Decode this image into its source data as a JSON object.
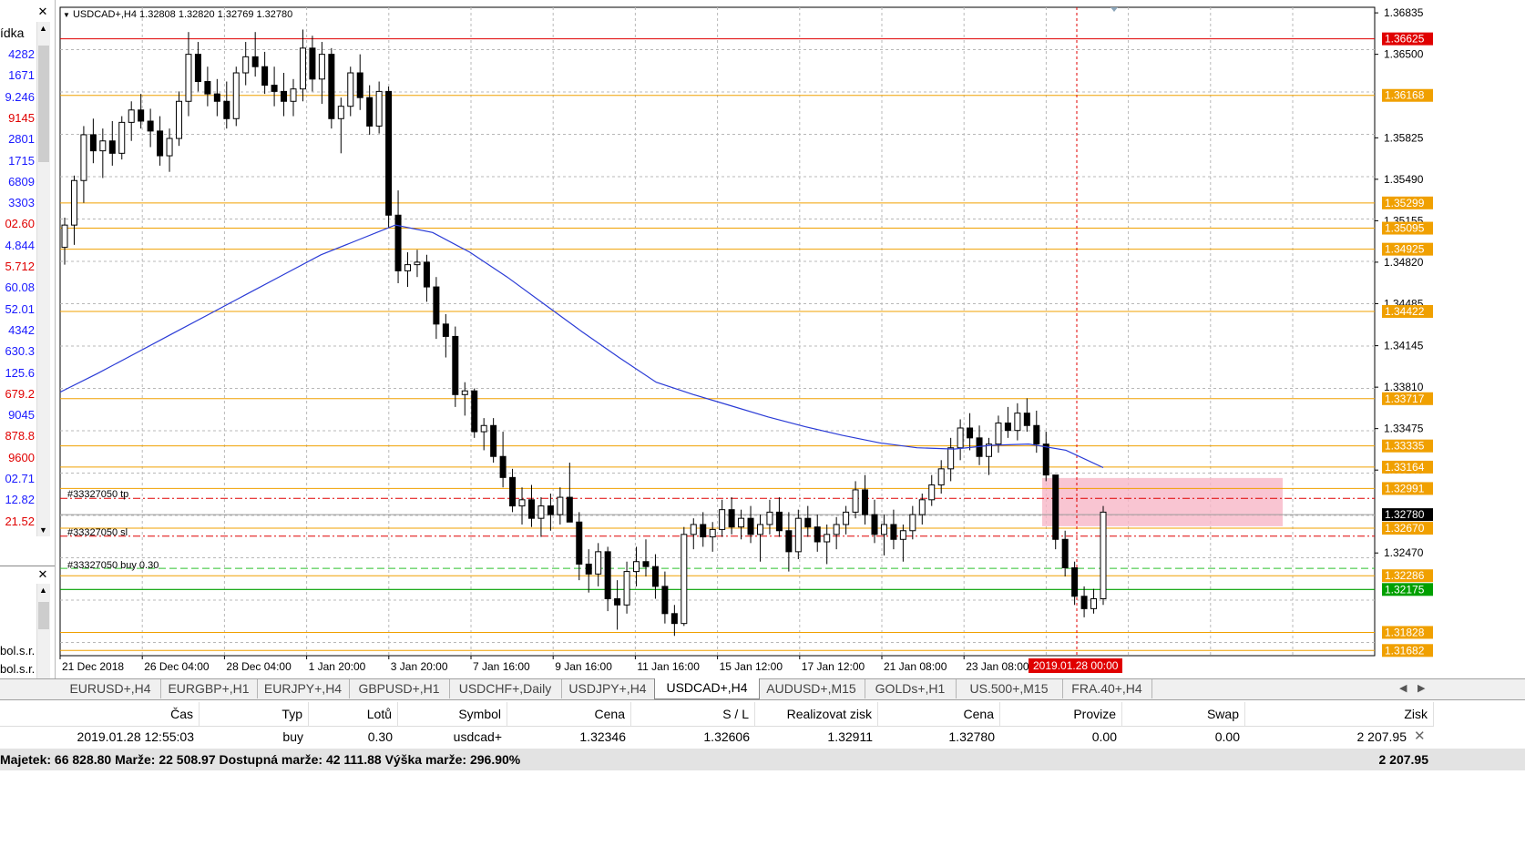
{
  "left_panel": {
    "header": "ídka",
    "rows": [
      {
        "text": "4282",
        "color": "#1a1aff"
      },
      {
        "text": "1671",
        "color": "#1a1aff"
      },
      {
        "text": "9.246",
        "color": "#1a1aff"
      },
      {
        "text": "9145",
        "color": "#e00000"
      },
      {
        "text": "2801",
        "color": "#1a1aff"
      },
      {
        "text": "1715",
        "color": "#1a1aff"
      },
      {
        "text": "6809",
        "color": "#1a1aff"
      },
      {
        "text": "3303",
        "color": "#1a1aff"
      },
      {
        "text": "02.60",
        "color": "#e00000"
      },
      {
        "text": "4.844",
        "color": "#1a1aff"
      },
      {
        "text": "5.712",
        "color": "#e00000"
      },
      {
        "text": "60.08",
        "color": "#1a1aff"
      },
      {
        "text": "52.01",
        "color": "#1a1aff"
      },
      {
        "text": "4342",
        "color": "#1a1aff"
      },
      {
        "text": "630.3",
        "color": "#1a1aff"
      },
      {
        "text": "125.6",
        "color": "#1a1aff"
      },
      {
        "text": "679.2",
        "color": "#e00000"
      },
      {
        "text": "9045",
        "color": "#1a1aff"
      },
      {
        "text": "878.8",
        "color": "#e00000"
      },
      {
        "text": "9600",
        "color": "#e00000"
      },
      {
        "text": "02.71",
        "color": "#1a1aff"
      },
      {
        "text": "12.82",
        "color": "#1a1aff"
      },
      {
        "text": "21.52",
        "color": "#e00000"
      }
    ],
    "nav_rows": [
      "bol.s.r.",
      "bol.s.r."
    ]
  },
  "chart": {
    "symbol_label": "USDCAD+,H4  1.32808 1.32820 1.32769 1.32780",
    "order_labels": {
      "tp": "#33327050 tp",
      "sl": "#33327050 sl",
      "buy": "#33327050 buy 0.30"
    },
    "price_min": 1.3164,
    "price_max": 1.3688,
    "axis_ticks": [
      "1.36835",
      "1.36500",
      "1.35825",
      "1.35490",
      "1.35155",
      "1.34820",
      "1.34485",
      "1.34145",
      "1.33810",
      "1.33475",
      "1.33140",
      "1.32470"
    ],
    "level_lines": [
      {
        "price": 1.36625,
        "label": "1.36625",
        "color": "#e00000"
      },
      {
        "price": 1.36168,
        "label": "1.36168",
        "color": "#f0a000"
      },
      {
        "price": 1.35299,
        "label": "1.35299",
        "color": "#f0a000"
      },
      {
        "price": 1.35095,
        "label": "1.35095",
        "color": "#f0a000"
      },
      {
        "price": 1.34925,
        "label": "1.34925",
        "color": "#f0a000"
      },
      {
        "price": 1.34422,
        "label": "1.34422",
        "color": "#f0a000"
      },
      {
        "price": 1.33717,
        "label": "1.33717",
        "color": "#f0a000"
      },
      {
        "price": 1.33335,
        "label": "1.33335",
        "color": "#f0a000"
      },
      {
        "price": 1.33164,
        "label": "1.33164",
        "color": "#f0a000"
      },
      {
        "price": 1.32991,
        "label": "1.32991",
        "color": "#f0a000"
      },
      {
        "price": 1.3267,
        "label": "1.32670",
        "color": "#f0a000"
      },
      {
        "price": 1.32286,
        "label": "1.32286",
        "color": "#f0a000"
      },
      {
        "price": 1.31828,
        "label": "1.31828",
        "color": "#f0a000"
      },
      {
        "price": 1.31682,
        "label": "1.31682",
        "color": "#f0a000"
      }
    ],
    "current_price": {
      "price": 1.3278,
      "label": "1.32780"
    },
    "entry_price": {
      "price": 1.32175,
      "label": "1.32175"
    },
    "tp_price": 1.32911,
    "sl_price": 1.32606,
    "buy_price": 1.32346,
    "zone": {
      "price_top": 1.33076,
      "price_bottom": 1.32686
    },
    "time_labels": [
      "21 Dec 2018",
      "26 Dec 04:00",
      "28 Dec 04:00",
      "1 Jan 20:00",
      "3 Jan 20:00",
      "7 Jan 16:00",
      "9 Jan 16:00",
      "11 Jan 16:00",
      "15 Jan 12:00",
      "17 Jan 12:00",
      "21 Jan 08:00",
      "23 Jan 08:00"
    ],
    "cursor_time_label": "2019.01.28 00:00",
    "ma_points": [
      [
        1.3377
      ],
      [
        1.3392
      ],
      [
        1.3408
      ],
      [
        1.3424
      ],
      [
        1.344
      ],
      [
        1.3456
      ],
      [
        1.3472
      ],
      [
        1.3488
      ],
      [
        1.35
      ],
      [
        1.3512
      ],
      [
        1.3506
      ],
      [
        1.349
      ],
      [
        1.347
      ],
      [
        1.3448
      ],
      [
        1.3426
      ],
      [
        1.3405
      ],
      [
        1.3385
      ],
      [
        1.3375
      ],
      [
        1.3366
      ],
      [
        1.3357
      ],
      [
        1.3349
      ],
      [
        1.3342
      ],
      [
        1.3336
      ],
      [
        1.3332
      ],
      [
        1.3331
      ],
      [
        1.3334
      ],
      [
        1.3335
      ],
      [
        1.333
      ],
      [
        1.3316
      ]
    ],
    "candles": [
      [
        1.3494,
        1.3518,
        1.348,
        1.3512
      ],
      [
        1.3512,
        1.3552,
        1.3496,
        1.3548
      ],
      [
        1.3548,
        1.3592,
        1.353,
        1.3585
      ],
      [
        1.3585,
        1.3598,
        1.3562,
        1.3572
      ],
      [
        1.3572,
        1.359,
        1.355,
        1.358
      ],
      [
        1.358,
        1.3596,
        1.356,
        1.357
      ],
      [
        1.357,
        1.36,
        1.3565,
        1.3595
      ],
      [
        1.3595,
        1.3612,
        1.358,
        1.3605
      ],
      [
        1.3605,
        1.3618,
        1.359,
        1.3596
      ],
      [
        1.3596,
        1.3606,
        1.3575,
        1.3588
      ],
      [
        1.3588,
        1.36,
        1.356,
        1.3568
      ],
      [
        1.3568,
        1.359,
        1.3555,
        1.3582
      ],
      [
        1.3582,
        1.362,
        1.3576,
        1.3612
      ],
      [
        1.3612,
        1.3668,
        1.36,
        1.365
      ],
      [
        1.365,
        1.366,
        1.362,
        1.3628
      ],
      [
        1.3628,
        1.364,
        1.3608,
        1.3618
      ],
      [
        1.3618,
        1.363,
        1.36,
        1.3612
      ],
      [
        1.3612,
        1.3628,
        1.359,
        1.3598
      ],
      [
        1.3598,
        1.364,
        1.3592,
        1.3635
      ],
      [
        1.3635,
        1.366,
        1.3625,
        1.3648
      ],
      [
        1.3648,
        1.3668,
        1.3632,
        1.364
      ],
      [
        1.364,
        1.3652,
        1.3618,
        1.3625
      ],
      [
        1.3625,
        1.364,
        1.3608,
        1.362
      ],
      [
        1.362,
        1.3635,
        1.36,
        1.3612
      ],
      [
        1.3612,
        1.363,
        1.36,
        1.3622
      ],
      [
        1.3622,
        1.367,
        1.3612,
        1.3655
      ],
      [
        1.3655,
        1.3665,
        1.362,
        1.363
      ],
      [
        1.363,
        1.366,
        1.361,
        1.365
      ],
      [
        1.365,
        1.3655,
        1.359,
        1.3598
      ],
      [
        1.3598,
        1.3615,
        1.357,
        1.3608
      ],
      [
        1.3608,
        1.364,
        1.36,
        1.3635
      ],
      [
        1.3635,
        1.365,
        1.3605,
        1.3615
      ],
      [
        1.3615,
        1.3625,
        1.3585,
        1.3592
      ],
      [
        1.3592,
        1.3628,
        1.3586,
        1.362
      ],
      [
        1.362,
        1.3624,
        1.351,
        1.352
      ],
      [
        1.352,
        1.354,
        1.3465,
        1.3475
      ],
      [
        1.3475,
        1.349,
        1.3462,
        1.348
      ],
      [
        1.348,
        1.3492,
        1.347,
        1.3482
      ],
      [
        1.3482,
        1.3488,
        1.345,
        1.3462
      ],
      [
        1.3462,
        1.347,
        1.342,
        1.3432
      ],
      [
        1.3432,
        1.344,
        1.3405,
        1.3422
      ],
      [
        1.3422,
        1.343,
        1.3365,
        1.3375
      ],
      [
        1.3375,
        1.3385,
        1.3358,
        1.3378
      ],
      [
        1.3378,
        1.338,
        1.334,
        1.3345
      ],
      [
        1.3345,
        1.3356,
        1.333,
        1.335
      ],
      [
        1.335,
        1.3356,
        1.332,
        1.3325
      ],
      [
        1.3325,
        1.3345,
        1.33,
        1.3308
      ],
      [
        1.3308,
        1.3315,
        1.328,
        1.3285
      ],
      [
        1.3285,
        1.33,
        1.327,
        1.329
      ],
      [
        1.329,
        1.3302,
        1.3268,
        1.3275
      ],
      [
        1.3275,
        1.3292,
        1.326,
        1.3285
      ],
      [
        1.3285,
        1.3295,
        1.3265,
        1.3278
      ],
      [
        1.3278,
        1.33,
        1.327,
        1.3292
      ],
      [
        1.3292,
        1.332,
        1.3285,
        1.3272
      ],
      [
        1.3272,
        1.328,
        1.3225,
        1.3238
      ],
      [
        1.3238,
        1.325,
        1.3215,
        1.323
      ],
      [
        1.323,
        1.3255,
        1.322,
        1.3248
      ],
      [
        1.3248,
        1.3252,
        1.32,
        1.321
      ],
      [
        1.321,
        1.3225,
        1.3185,
        1.3205
      ],
      [
        1.3205,
        1.324,
        1.3198,
        1.3232
      ],
      [
        1.3232,
        1.3252,
        1.322,
        1.324
      ],
      [
        1.324,
        1.3258,
        1.3228,
        1.3236
      ],
      [
        1.3236,
        1.3246,
        1.321,
        1.322
      ],
      [
        1.322,
        1.3232,
        1.319,
        1.3198
      ],
      [
        1.3198,
        1.3205,
        1.318,
        1.319
      ],
      [
        1.319,
        1.3268,
        1.3188,
        1.3262
      ],
      [
        1.3262,
        1.3275,
        1.325,
        1.327
      ],
      [
        1.327,
        1.328,
        1.3252,
        1.326
      ],
      [
        1.326,
        1.3272,
        1.3248,
        1.3266
      ],
      [
        1.3266,
        1.329,
        1.326,
        1.3282
      ],
      [
        1.3282,
        1.3292,
        1.3262,
        1.3268
      ],
      [
        1.3268,
        1.3282,
        1.3258,
        1.3275
      ],
      [
        1.3275,
        1.3285,
        1.3255,
        1.3262
      ],
      [
        1.3262,
        1.3278,
        1.324,
        1.327
      ],
      [
        1.327,
        1.329,
        1.3262,
        1.328
      ],
      [
        1.328,
        1.3292,
        1.326,
        1.3265
      ],
      [
        1.3265,
        1.328,
        1.3232,
        1.3248
      ],
      [
        1.3248,
        1.3282,
        1.3242,
        1.3275
      ],
      [
        1.3275,
        1.3285,
        1.326,
        1.3268
      ],
      [
        1.3268,
        1.3278,
        1.3248,
        1.3256
      ],
      [
        1.3256,
        1.327,
        1.3238,
        1.3262
      ],
      [
        1.3262,
        1.3276,
        1.325,
        1.327
      ],
      [
        1.327,
        1.3285,
        1.3262,
        1.328
      ],
      [
        1.328,
        1.3305,
        1.3275,
        1.3298
      ],
      [
        1.3298,
        1.331,
        1.327,
        1.3278
      ],
      [
        1.3278,
        1.329,
        1.3255,
        1.3262
      ],
      [
        1.3262,
        1.3278,
        1.3245,
        1.327
      ],
      [
        1.327,
        1.3282,
        1.325,
        1.3258
      ],
      [
        1.3258,
        1.327,
        1.324,
        1.3265
      ],
      [
        1.3265,
        1.3285,
        1.3258,
        1.3278
      ],
      [
        1.3278,
        1.3295,
        1.327,
        1.329
      ],
      [
        1.329,
        1.331,
        1.3285,
        1.3302
      ],
      [
        1.3302,
        1.3322,
        1.3295,
        1.3315
      ],
      [
        1.3315,
        1.334,
        1.3305,
        1.3332
      ],
      [
        1.3332,
        1.3355,
        1.3322,
        1.3348
      ],
      [
        1.3348,
        1.336,
        1.333,
        1.334
      ],
      [
        1.334,
        1.335,
        1.3318,
        1.3325
      ],
      [
        1.3325,
        1.334,
        1.331,
        1.3335
      ],
      [
        1.3335,
        1.3358,
        1.3328,
        1.3352
      ],
      [
        1.3352,
        1.3365,
        1.334,
        1.3346
      ],
      [
        1.3346,
        1.3368,
        1.3338,
        1.336
      ],
      [
        1.336,
        1.3372,
        1.3345,
        1.335
      ],
      [
        1.335,
        1.3362,
        1.3328,
        1.3335
      ],
      [
        1.3335,
        1.3345,
        1.3305,
        1.331
      ],
      [
        1.331,
        1.3268,
        1.325,
        1.3258
      ],
      [
        1.3258,
        1.3265,
        1.3228,
        1.3235
      ],
      [
        1.3235,
        1.324,
        1.3205,
        1.3212
      ],
      [
        1.3212,
        1.322,
        1.3195,
        1.3202
      ],
      [
        1.3202,
        1.3218,
        1.3198,
        1.321
      ],
      [
        1.321,
        1.3285,
        1.3205,
        1.328
      ]
    ]
  },
  "tabs": [
    {
      "label": "EURUSD+,H4",
      "active": false
    },
    {
      "label": "EURGBP+,H1",
      "active": false
    },
    {
      "label": "EURJPY+,H4",
      "active": false
    },
    {
      "label": "GBPUSD+,H1",
      "active": false
    },
    {
      "label": "USDCHF+,Daily",
      "active": false
    },
    {
      "label": "USDJPY+,H4",
      "active": false
    },
    {
      "label": "USDCAD+,H4",
      "active": true
    },
    {
      "label": "AUDUSD+,M15",
      "active": false
    },
    {
      "label": "GOLDs+,H1",
      "active": false
    },
    {
      "label": "US.500+,M15",
      "active": false
    },
    {
      "label": "FRA.40+,H4",
      "active": false
    }
  ],
  "table": {
    "headers": [
      "Čas",
      "Typ",
      "Lotů",
      "Symbol",
      "Cena",
      "S / L",
      "Realizovat zisk",
      "Cena",
      "Provize",
      "Swap",
      "Zisk"
    ],
    "row": [
      "2019.01.28 12:55:03",
      "buy",
      "0.30",
      "usdcad+",
      "1.32346",
      "1.32606",
      "1.32911",
      "1.32780",
      "0.00",
      "0.00",
      "2 207.95"
    ]
  },
  "summary": {
    "text": "Majetek: 66 828.80  Marže: 22 508.97  Dostupná marže: 42 111.88  Výška marže: 296.90%",
    "total": "2 207.95"
  }
}
